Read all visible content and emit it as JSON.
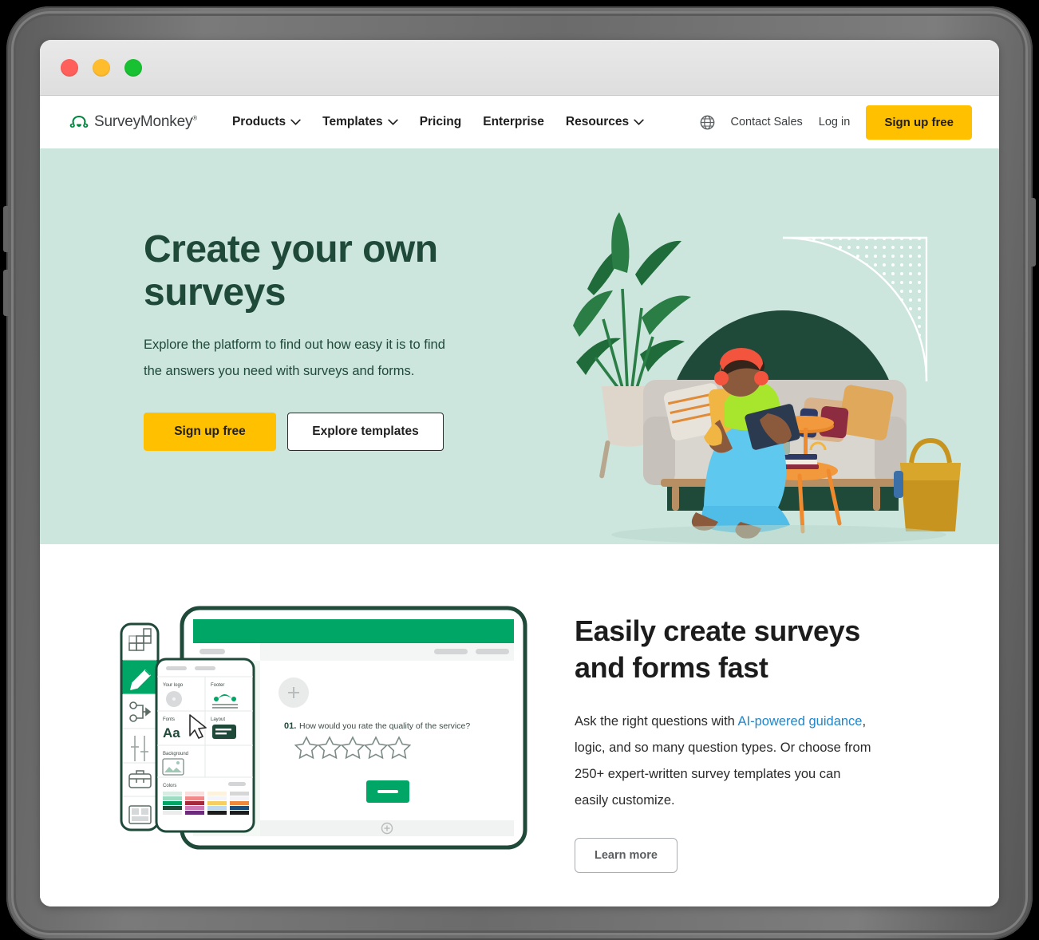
{
  "window": {
    "traffic_lights": [
      "close",
      "minimize",
      "zoom"
    ]
  },
  "nav": {
    "brand": "SurveyMonkey",
    "brand_trademark": "®",
    "links": [
      {
        "label": "Products",
        "has_dropdown": true
      },
      {
        "label": "Templates",
        "has_dropdown": true
      },
      {
        "label": "Pricing",
        "has_dropdown": false
      },
      {
        "label": "Enterprise",
        "has_dropdown": false
      },
      {
        "label": "Resources",
        "has_dropdown": true
      }
    ],
    "language_icon": "globe-icon",
    "contact_sales": "Contact Sales",
    "log_in": "Log in",
    "sign_up": "Sign up free"
  },
  "hero": {
    "title": "Create your own surveys",
    "subtitle": "Explore the platform to find out how easy it is to find the answers you need with surveys and forms.",
    "primary_cta": "Sign up free",
    "secondary_cta": "Explore templates",
    "background_color": "#cce5dd",
    "text_color": "#1f4a3a"
  },
  "feature": {
    "title": "Easily create surveys and forms fast",
    "body_before_link": "Ask the right questions with ",
    "link_text": "AI-powered guidance",
    "body_after_link": ", logic, and so many question types. Or choose from 250+ expert-written survey templates you can easily customize.",
    "link_color": "#1f86c9",
    "cta": "Learn more"
  },
  "illustration": {
    "toolbar_icons": [
      "build-grid-icon",
      "design-pencil-icon",
      "logic-branch-icon",
      "options-sliders-icon",
      "toolbox-icon",
      "layout-icon"
    ],
    "active_toolbar_icon": "design-pencil-icon",
    "panel_sections": [
      {
        "label": "Your logo"
      },
      {
        "label": "Footer"
      },
      {
        "label": "Fonts",
        "sample": "Aa"
      },
      {
        "label": "Layout"
      },
      {
        "label": "Background"
      },
      {
        "label": "Colors"
      }
    ],
    "question_number": "01.",
    "question_text": "How would you rate the quality of the service?",
    "star_count": 5,
    "accent_green": "#00a665",
    "outline_green": "#1f4a3a",
    "palettes": [
      [
        "#d8ece3",
        "#9ddcc2",
        "#00a665",
        "#1f4a3a",
        "#e8e8e8"
      ],
      [
        "#fadddd",
        "#f08a8a",
        "#a32b3c",
        "#cf7bb8",
        "#6b2a7a"
      ],
      [
        "#fdf3dd",
        "#fbe3a6",
        "#f6cf63",
        "#bcd9ef",
        "#1c1c1c"
      ],
      [
        "#ececec",
        "#f3f3f8",
        "#ef8a3c",
        "#1a4d7a",
        "#1c1c1c"
      ]
    ]
  }
}
